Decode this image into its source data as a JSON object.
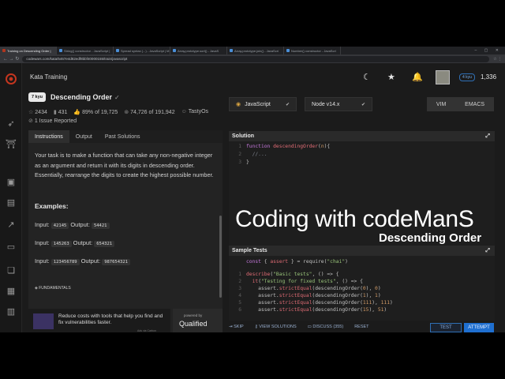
{
  "browser": {
    "tabs": [
      {
        "label": "Training on Descending Order |",
        "active": true
      },
      {
        "label": "String() constructor - JavaScript |"
      },
      {
        "label": "Spread syntax (...) - JavaScript | M"
      },
      {
        "label": "Array.prototype.sort() - JavaS"
      },
      {
        "label": "Array.prototype.join() - JavaScri"
      },
      {
        "label": "Number() constructor - JavaScri"
      }
    ],
    "url": "codewars.com/kata/5467e4d82edf8bbf40000155/train/javascript"
  },
  "header": {
    "title": "Kata Training",
    "rank_badge": "4 kyu",
    "honor": "1,336"
  },
  "kata": {
    "kyu": "7 kyu",
    "name": "Descending Order",
    "stats": {
      "stars": "2434",
      "favorites": "431",
      "satisfaction": "89% of 19,725",
      "completed": "74,726 of 191,942",
      "author": "TastyOs"
    },
    "issues": "1 Issue Reported"
  },
  "panel": {
    "tabs": [
      "Instructions",
      "Output",
      "Past Solutions"
    ],
    "description": "Your task is to make a function that can take any non-negative integer as an argument and return it with its digits in descending order. Essentially, rearrange the digits to create the highest possible number.",
    "examples_heading": "Examples:",
    "examples": [
      {
        "input_label": "Input:",
        "input": "42145",
        "output_label": "Output:",
        "output": "54421"
      },
      {
        "input_label": "Input:",
        "input": "145263",
        "output_label": "Output:",
        "output": "654321"
      },
      {
        "input_label": "Input:",
        "input": "123456789",
        "output_label": "Output:",
        "output": "987654321"
      }
    ],
    "tag": "FUNDAMENTALS"
  },
  "ad": {
    "text": "Reduce costs with tools that help you find and fix vulnerabilities faster.",
    "via": "Ads via Carbon",
    "powered_by": "powered by",
    "brand": "Qualified"
  },
  "editor": {
    "language": "JavaScript",
    "runtime": "Node v14.x",
    "modes": [
      "VIM",
      "EMACS"
    ],
    "solution_title": "Solution",
    "solution_lines": [
      "1",
      "2",
      "3"
    ],
    "tests_title": "Sample Tests",
    "test_lines": [
      "1",
      "2",
      "3",
      "4",
      "5",
      "6",
      "7",
      "8"
    ]
  },
  "overlay": {
    "line1": "Coding with codeManS",
    "line2": "Descending Order"
  },
  "footer": {
    "skip": "SKIP",
    "view_solutions": "VIEW SOLUTIONS",
    "discuss": "DISCUSS (355)",
    "reset": "RESET",
    "test": "TEST",
    "attempt": "ATTEMPT"
  }
}
